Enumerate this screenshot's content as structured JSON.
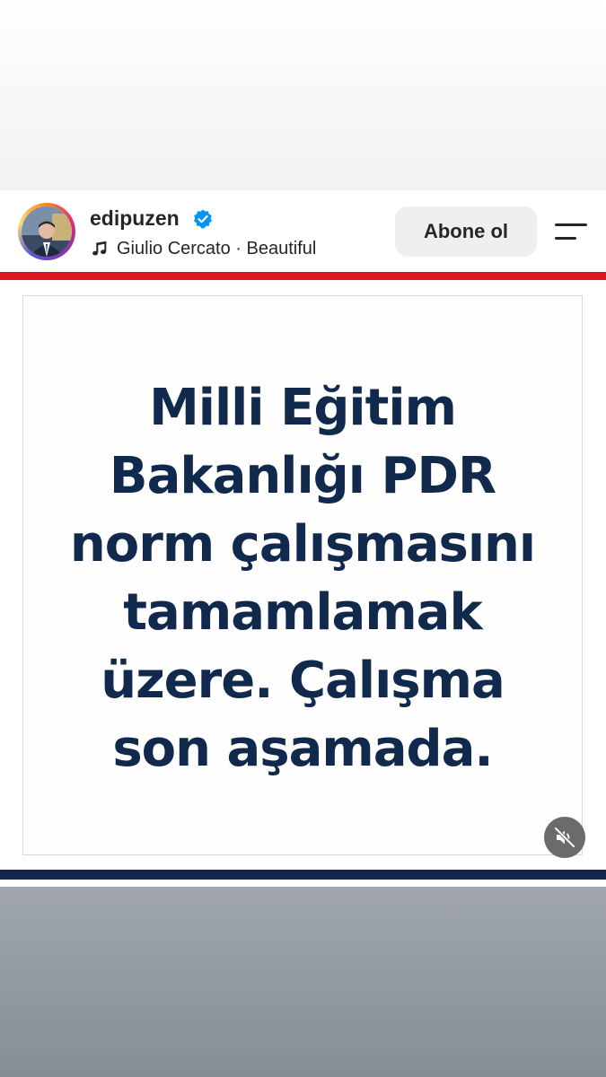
{
  "post": {
    "username": "edipuzen",
    "verified": true,
    "music": "Giulio Cercato · Beautiful",
    "follow_label": "Abone ol",
    "headline": "Milli Eğitim Bakanlığı PDR norm çalışmasını tamamlamak üzere. Çalışma son aşamada."
  },
  "icons": {
    "verified": "verified-badge-icon",
    "music": "music-note-icon",
    "menu": "menu-icon",
    "mute": "speaker-muted-icon"
  },
  "colors": {
    "accent_red": "#e0141e",
    "navy": "#12284a",
    "headline_text": "#10294d",
    "verified_blue": "#0095f6"
  }
}
